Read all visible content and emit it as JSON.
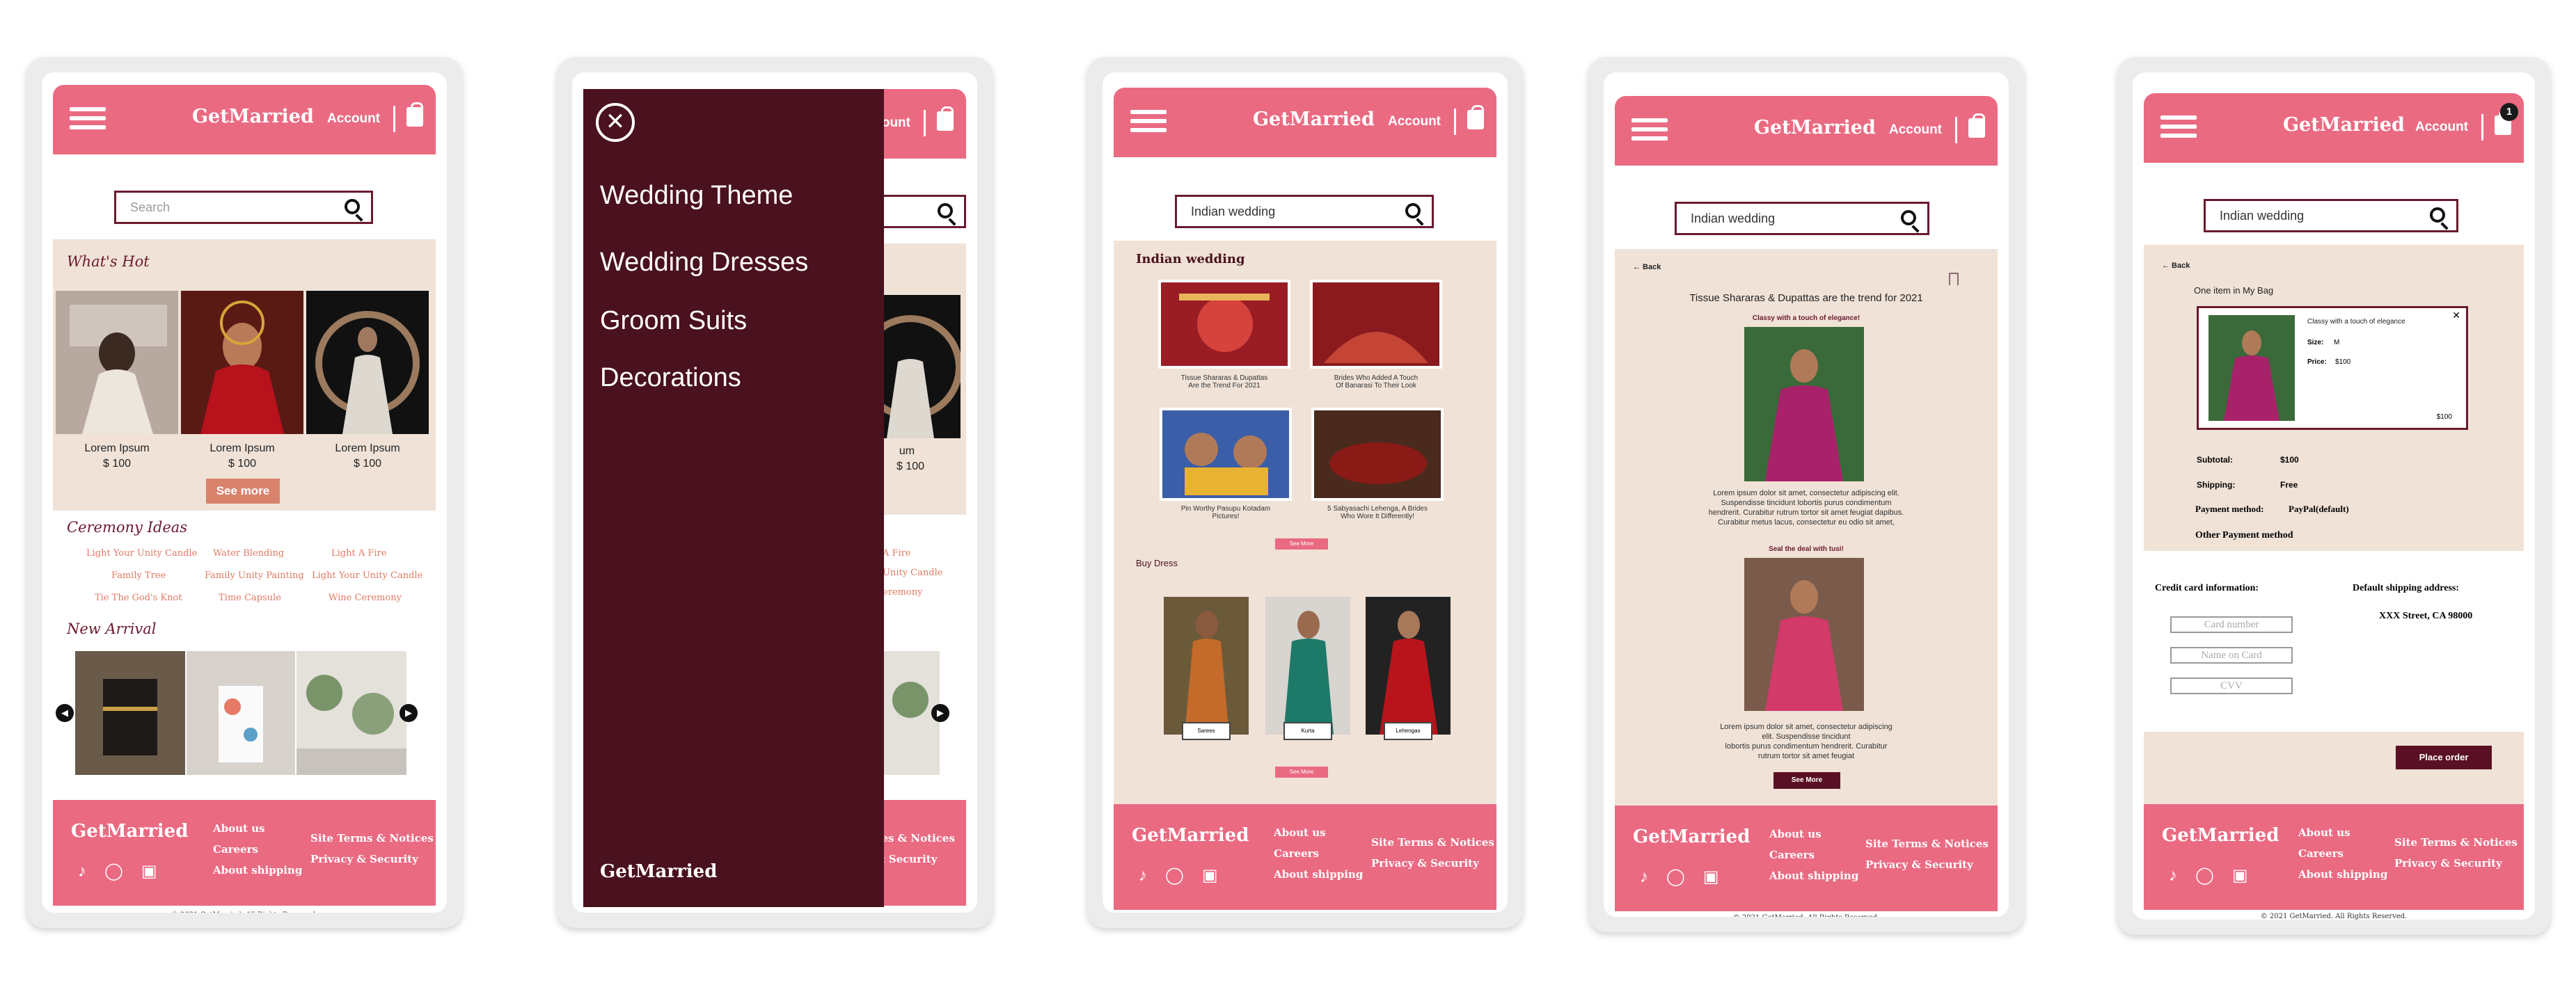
{
  "brand": "GetMarried",
  "header": {
    "account": "Account",
    "bag_count": "1"
  },
  "search": {
    "placeholder": "Search",
    "query": "Indian wedding"
  },
  "footer": {
    "brand": "GetMarried",
    "col1": [
      "About us",
      "Careers",
      "About shipping"
    ],
    "col2": [
      "Site Terms & Notices",
      "Privacy & Security"
    ],
    "copyright": "© 2021 GetMarried. All Rights Reserved.",
    "social_icons": [
      "tiktok-icon",
      "instagram-icon",
      "facebook-icon"
    ]
  },
  "home": {
    "whats_hot": "What's Hot",
    "products": [
      {
        "name": "Lorem Ipsum",
        "price": "$ 100"
      },
      {
        "name": "Lorem Ipsum",
        "price": "$ 100"
      },
      {
        "name": "Lorem Ipsum",
        "price": "$ 100"
      }
    ],
    "see_more": "See more",
    "ceremony_title": "Ceremony Ideas",
    "ideas": [
      "Light Your Unity Candle",
      "Water Blending",
      "Light A Fire",
      "Family Tree",
      "Family Unity Painting",
      "Light Your Unity Candle",
      "Tie The God's Knot",
      "Time Capsule",
      "Wine Ceremony"
    ],
    "new_arrival": "New Arrival"
  },
  "menu": {
    "items": [
      "Wedding Theme",
      "Wedding Dresses",
      "Groom Suits",
      "Decorations"
    ],
    "brand": "GetMarried",
    "peek": {
      "account": "ount",
      "price": "$ 100",
      "price_label": "um",
      "ideas": [
        "A Fire",
        "Unity Candle",
        "eremony"
      ]
    }
  },
  "results": {
    "title": "Indian wedding",
    "captions": [
      "Tissue Shararas & Dupattas\nAre the Trend For 2021",
      "Brides Who Added A Touch\nOf Banarasi To Their Look",
      "Pin Worthy Pasupu Kotadam\nPictures!",
      "5 Sabyasachi Lehenga, A Brides\nWho Wore It Differently!"
    ],
    "see_more": "See More",
    "buy_dress": "Buy Dress",
    "dress_labels": [
      "Sarees",
      "Kurta",
      "Lehengas"
    ]
  },
  "article": {
    "back": "← Back",
    "headline": "Tissue Shararas & Dupattas are the trend for 2021",
    "sub1": "Classy with a touch of elegance!",
    "para1": "Lorem ipsum dolor sit amet, consectetur adipiscing elit.\nSuspendisse tincidunt lobortis purus condimentum\nhendrerit. Curabitur rutrum tortor sit amet feugiat dapibus.\nCurabitur metus lacus, consectetur eu odio sit amet,",
    "sub2": "Seal the deal with tusi!",
    "para2": "Lorem ipsum dolor sit amet, consectetur adipiscing\nelit. Suspendisse tincidunt\nlobortis purus condimentum hendrerit. Curabitur\nrutrum tortor sit amet feugiat",
    "see_more": "See More"
  },
  "cart": {
    "back": "← Back",
    "count_text": "One item in My Bag",
    "item_name": "Classy with a touch of elegance",
    "size_label": "Size:",
    "size": "M",
    "price_label": "Price:",
    "price": "$100",
    "line_total": "$100",
    "subtotal_label": "Subtotal:",
    "subtotal": "$100",
    "shipping_label": "Shipping:",
    "shipping": "Free",
    "payment_label": "Payment method:",
    "payment": "PayPal(default)",
    "other_payment": "Other Payment method",
    "cc_title": "Credit card information:",
    "card_number": "Card number",
    "name_on_card": "Name on Card",
    "cvv": "CVV",
    "ship_title": "Default shipping address:",
    "address": "XXX Street, CA 98000",
    "place_order": "Place order"
  },
  "colors": {
    "primary": "#ea6a82",
    "dark": "#4a111f",
    "beige": "#f0e2d7"
  }
}
